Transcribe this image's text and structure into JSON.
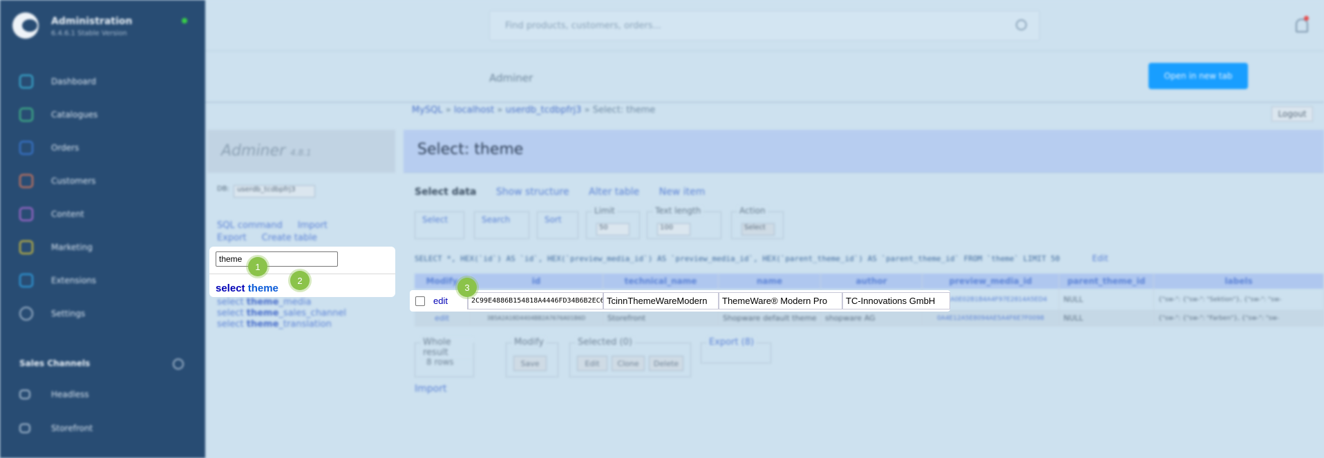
{
  "sidebar": {
    "title": "Administration",
    "version": "6.4.6.1 Stable Version",
    "items": [
      "Dashboard",
      "Catalogues",
      "Orders",
      "Customers",
      "Content",
      "Marketing",
      "Extensions",
      "Settings"
    ],
    "sales_channels_label": "Sales Channels",
    "channels": [
      "Headless",
      "Storefront"
    ]
  },
  "topbar": {
    "search_placeholder": "Find products, customers, orders..."
  },
  "subbar": {
    "title": "Adminer",
    "open_button": "Open in new tab"
  },
  "adminer": {
    "breadcrumb": {
      "db_type": "MySQL",
      "host": "localhost",
      "db": "userdb_tcdbpfrj3",
      "current": "Select: theme",
      "separator": "»"
    },
    "logout": "Logout",
    "logo": "Adminer",
    "logo_version": "4.8.1",
    "db_label": "DB:",
    "db_value": "userdb_tcdbpfrj3",
    "links": [
      "SQL command",
      "Import",
      "Export",
      "Create table"
    ],
    "table_filter_value": "theme",
    "tables": [
      {
        "prefix": "select ",
        "name": "theme",
        "suffix": ""
      },
      {
        "prefix": "select ",
        "name": "theme",
        "suffix": "_media"
      },
      {
        "prefix": "select ",
        "name": "theme",
        "suffix": "_sales_channel"
      },
      {
        "prefix": "select ",
        "name": "theme",
        "suffix": "_translation"
      }
    ],
    "heading": "Select: theme",
    "tabs": [
      "Select data",
      "Show structure",
      "Alter table",
      "New item"
    ],
    "fieldsets": {
      "select": "Select",
      "search": "Search",
      "sort": "Sort",
      "limit": "Limit",
      "limit_value": "50",
      "text_length": "Text length",
      "text_length_value": "100",
      "action": "Action",
      "action_button": "Select"
    },
    "sql_query": "SELECT *, HEX(`id`) AS `id`, HEX(`preview_media_id`) AS `preview_media_id`, HEX(`parent_theme_id`) AS `parent_theme_id` FROM `theme` LIMIT 50",
    "sql_edit": "Edit",
    "columns": [
      "Modify",
      "id",
      "technical_name",
      "name",
      "author",
      "preview_media_id",
      "parent_theme_id",
      "labels"
    ],
    "rows": [
      {
        "edit": "edit",
        "id": "2C99E4886B154818A4446FD34B6B2EC6",
        "technical_name": "TcinnThemeWareModern",
        "name": "ThemeWare® Modern Pro",
        "author": "TC-Innovations GmbH",
        "preview_media_id": "0A21A0E02B1B4A4F97E2814A5ED4",
        "parent_theme_id": "NULL",
        "labels": "{\"sw-\": {\"sw-\": \"Sektion\"}, {\"sw-\": \"sw-"
      },
      {
        "edit": "edit",
        "id": "3B5A2A18D4404BB2A7676A01B6D",
        "technical_name": "Storefront",
        "name": "Shopware default theme",
        "author": "shopware AG",
        "preview_media_id": "0A4E12A5E8094AE5A4F6E7F0098",
        "parent_theme_id": "NULL",
        "labels": "{\"sw-\": {\"sw-\": \"Farben\"}, {\"sw-\": \"sw-"
      }
    ],
    "bottom": {
      "whole_result": "Whole result",
      "rows_count": "8 rows",
      "modify": "Modify",
      "save": "Save",
      "selected": "Selected (0)",
      "edit": "Edit",
      "clone": "Clone",
      "delete": "Delete",
      "export": "Export (8)",
      "import": "Import"
    }
  },
  "badges": [
    "1",
    "2",
    "3"
  ],
  "colors": {
    "sidebar_bg": "#284c73",
    "accent_blue": "#189eff",
    "badge_green": "#8bc34a",
    "link_blue": "#0000b6"
  }
}
